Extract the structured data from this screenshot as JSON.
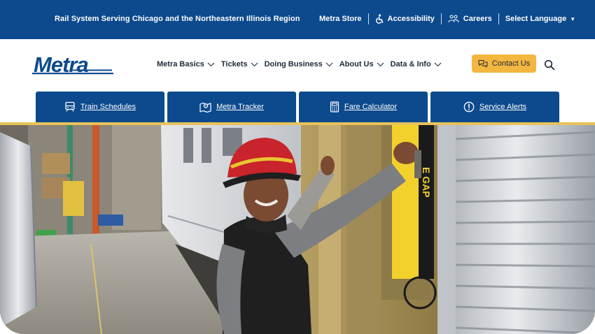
{
  "topbar": {
    "tagline": "Rail System Serving Chicago and the Northeastern Illinois Region",
    "links": [
      {
        "label": "Metra Store",
        "icon": ""
      },
      {
        "label": "Accessibility",
        "icon": "accessibility-icon"
      },
      {
        "label": "Careers",
        "icon": "people-icon"
      }
    ],
    "language": "Select Language",
    "language_icon": "caret-down-icon"
  },
  "header": {
    "logo_text": "Metra",
    "nav": [
      {
        "label": "Metra Basics",
        "icon": "chevron-down-icon"
      },
      {
        "label": "Tickets",
        "icon": "chevron-down-icon"
      },
      {
        "label": "Doing Business",
        "icon": "chevron-down-icon"
      },
      {
        "label": "About Us",
        "icon": "chevron-down-icon"
      },
      {
        "label": "Data & Info",
        "icon": "chevron-down-icon"
      }
    ],
    "contact_label": "Contact Us",
    "contact_icon": "chat-icon",
    "search_icon": "search-icon"
  },
  "quick_links": [
    {
      "label": "Train Schedules",
      "icon": "train-icon"
    },
    {
      "label": "Metra Tracker",
      "icon": "map-pin-icon"
    },
    {
      "label": "Fare Calculator",
      "icon": "calculator-icon"
    },
    {
      "label": "Service Alerts",
      "icon": "alert-icon"
    }
  ],
  "hero": {
    "door_sign_text": "E GAP"
  },
  "colors": {
    "brand_blue": "#0c4a8d",
    "accent_gold": "#f3b63f",
    "divider_gold": "#e8c25a"
  }
}
